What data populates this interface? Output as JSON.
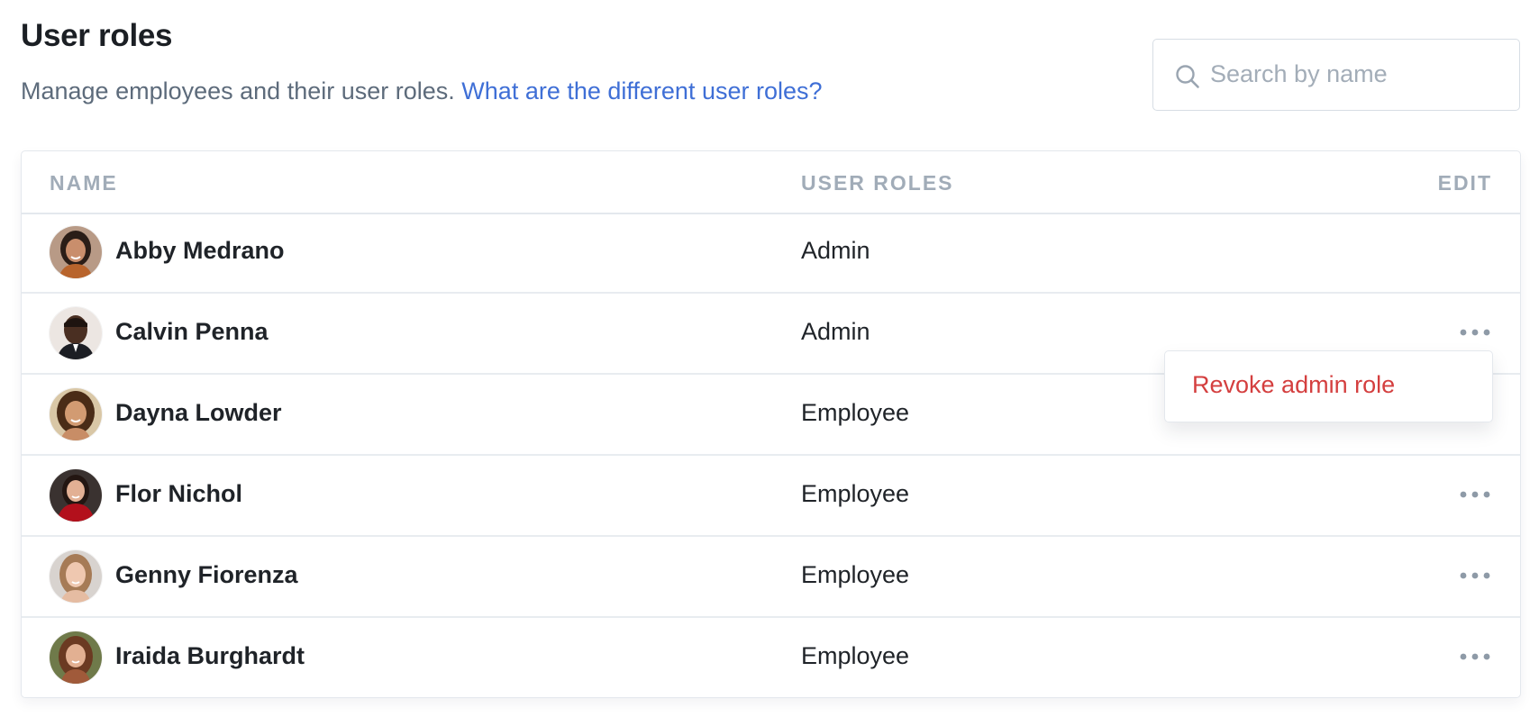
{
  "header": {
    "title": "User roles",
    "subtitle": "Manage employees and their user roles.",
    "help_link": "What are the different user roles?"
  },
  "search": {
    "placeholder": "Search by name",
    "value": "",
    "icon": "search-icon"
  },
  "table": {
    "columns": {
      "name": "NAME",
      "roles": "USER ROLES",
      "edit": "EDIT"
    },
    "rows": [
      {
        "name": "Abby Medrano",
        "role": "Admin",
        "has_menu": false
      },
      {
        "name": "Calvin Penna",
        "role": "Admin",
        "has_menu": true
      },
      {
        "name": "Dayna Lowder",
        "role": "Employee",
        "has_menu": false
      },
      {
        "name": "Flor Nichol",
        "role": "Employee",
        "has_menu": true
      },
      {
        "name": "Genny Fiorenza",
        "role": "Employee",
        "has_menu": true
      },
      {
        "name": "Iraida Burghardt",
        "role": "Employee",
        "has_menu": true
      }
    ]
  },
  "dropdown": {
    "item": "Revoke admin role"
  },
  "colors": {
    "link": "#3f6fd6",
    "danger": "#d43f3f",
    "muted": "#a1acb8",
    "text": "#1f2328"
  }
}
